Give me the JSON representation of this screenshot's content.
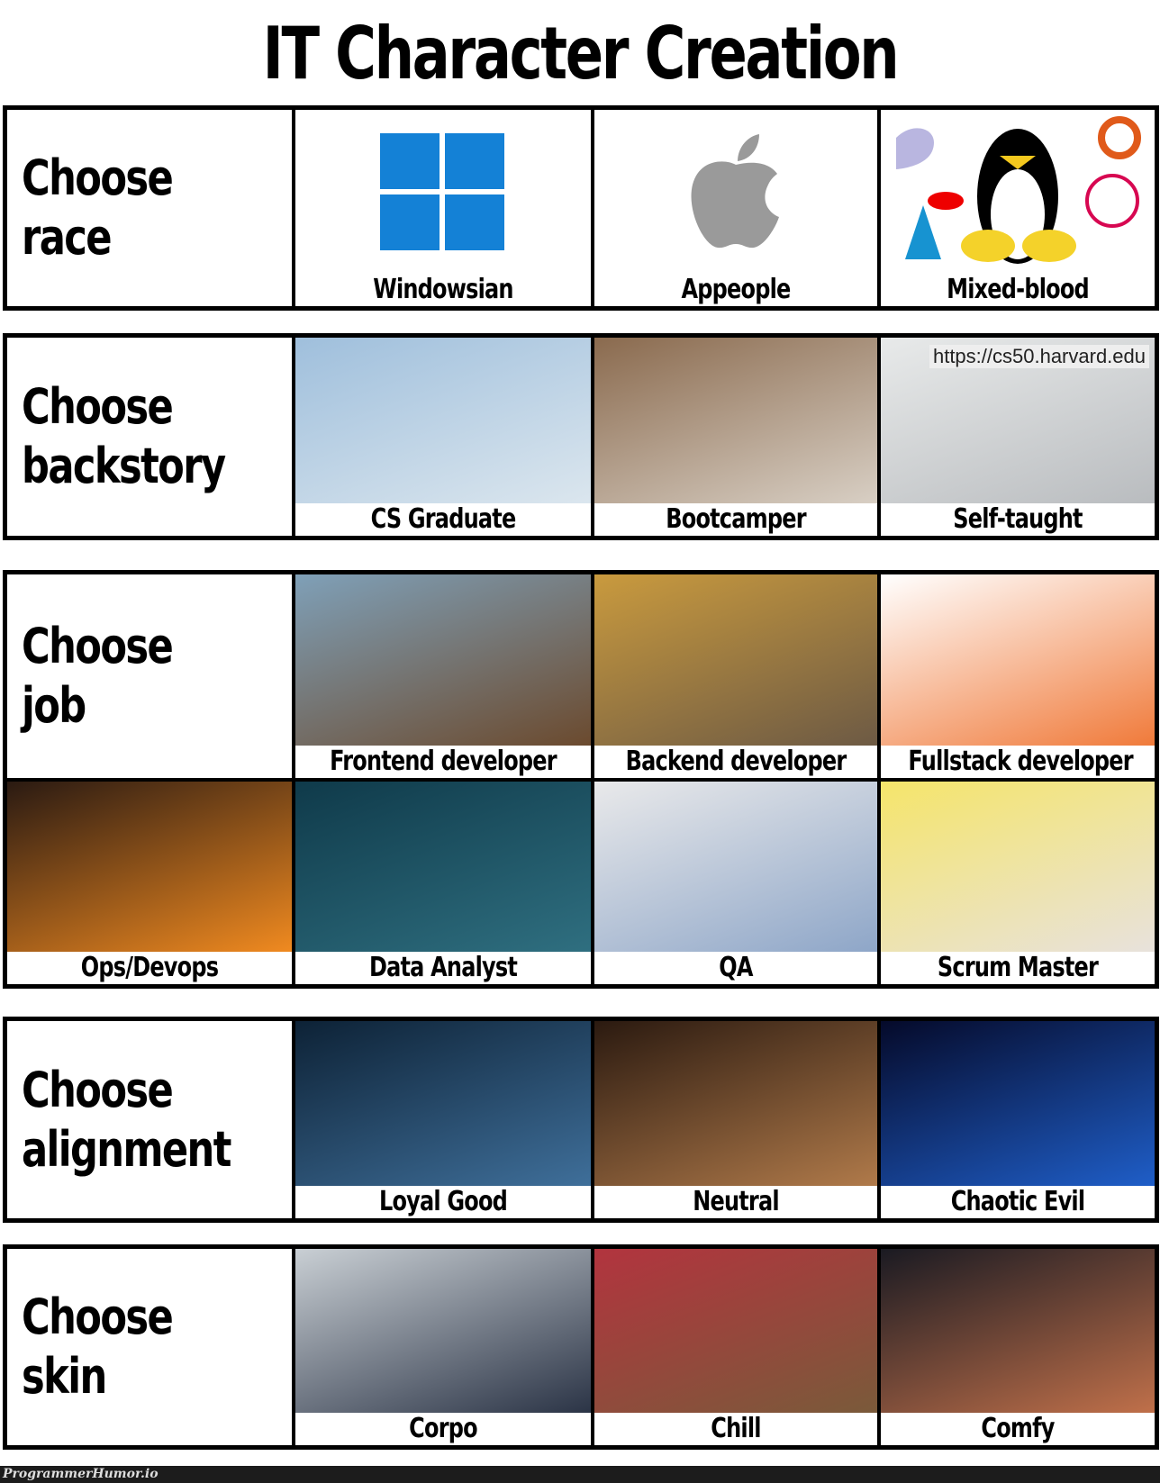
{
  "title": "IT Character Creation",
  "rows": [
    {
      "heading": "Choose race",
      "options": [
        {
          "label": "Windowsian",
          "icon": "windows-logo-icon"
        },
        {
          "label": "Appeople",
          "icon": "apple-logo-icon"
        },
        {
          "label": "Mixed-blood",
          "icon": "linux-tux-icon"
        }
      ]
    },
    {
      "heading": "Choose\nbackstory",
      "options": [
        {
          "label": "CS Graduate",
          "photo_colors": [
            "#9fbfdc",
            "#dbe6ee"
          ]
        },
        {
          "label": "Bootcamper",
          "photo_colors": [
            "#8a6a4e",
            "#d8cfc4"
          ]
        },
        {
          "label": "Self-taught",
          "photo_colors": [
            "#e8eaea",
            "#b9bcbf"
          ],
          "overlay_text": "https://cs50.harvard.edu"
        }
      ]
    },
    {
      "heading": "Choose job",
      "options": [
        {
          "label": "Frontend developer",
          "photo_colors": [
            "#7fa0b8",
            "#6b4a2e"
          ]
        },
        {
          "label": "Backend developer",
          "photo_colors": [
            "#c99a3e",
            "#6d5a44"
          ]
        },
        {
          "label": "Fullstack developer",
          "photo_colors": [
            "#ffffff",
            "#f07a3a"
          ]
        },
        {
          "label": "Ops/Devops",
          "photo_colors": [
            "#2a1a12",
            "#f08a20"
          ]
        },
        {
          "label": "Data Analyst",
          "photo_colors": [
            "#0f3a4a",
            "#2f6f80"
          ]
        },
        {
          "label": "QA",
          "photo_colors": [
            "#e9e9ea",
            "#8ea6c8"
          ]
        },
        {
          "label": "Scrum Master",
          "photo_colors": [
            "#f5e56a",
            "#e8e2dc"
          ]
        }
      ]
    },
    {
      "heading": "Choose\nalignment",
      "options": [
        {
          "label": "Loyal Good",
          "photo_colors": [
            "#0d2236",
            "#3f6f9a"
          ]
        },
        {
          "label": "Neutral",
          "photo_colors": [
            "#2b1a10",
            "#b07a4a"
          ]
        },
        {
          "label": "Chaotic Evil",
          "photo_colors": [
            "#050a2a",
            "#1f5ec8"
          ]
        }
      ]
    },
    {
      "heading": "Choose skin",
      "options": [
        {
          "label": "Corpo",
          "photo_colors": [
            "#c9cfd4",
            "#2b3446"
          ]
        },
        {
          "label": "Chill",
          "photo_colors": [
            "#b2343e",
            "#7a5a3a"
          ]
        },
        {
          "label": "Comfy",
          "photo_colors": [
            "#1a1a22",
            "#c0704a"
          ]
        }
      ]
    }
  ],
  "watermark": "ProgrammerHumor.io"
}
